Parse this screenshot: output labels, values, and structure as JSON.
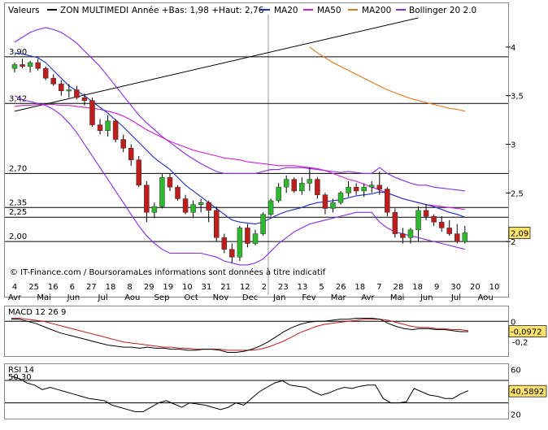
{
  "legend": {
    "title": "Valeurs",
    "instrument": "ZON MULTIMEDI",
    "range": "Année +Bas: 1,98 +Haut: 2,76",
    "items": [
      {
        "label": "MA20",
        "color": "#1f2fbf"
      },
      {
        "label": "MA50",
        "color": "#cc22cc"
      },
      {
        "label": "MA200",
        "color": "#e07a1e"
      },
      {
        "label": "Bollinger 20 2.0",
        "color": "#8a2be2"
      }
    ]
  },
  "colors": {
    "up": "#2db82d",
    "down": "#c01c1c",
    "grid": "#000000",
    "current_value_bg": "#ffe36e"
  },
  "watermark": "© IT-Finance.com / BoursoramaLes informations sont données à titre indicatif",
  "chart_data": [
    {
      "type": "candlestick",
      "title": "",
      "ylim": [
        1.6,
        4.3
      ],
      "y_ticks": [
        2,
        2.5,
        3,
        3.5,
        4
      ],
      "y_tick_labels": [
        "2",
        "2,5",
        "3",
        "3,5",
        "4"
      ],
      "levels": [
        {
          "value": 3.9,
          "label": "3,90"
        },
        {
          "value": 3.42,
          "label": "3,42"
        },
        {
          "value": 2.7,
          "label": "2,70"
        },
        {
          "value": 2.35,
          "label": "2,35"
        },
        {
          "value": 2.25,
          "label": "2,25"
        },
        {
          "value": 2.0,
          "label": "2,00"
        }
      ],
      "current_value": {
        "value": 2.09,
        "label": "2,09"
      },
      "x_ticks": [
        {
          "label": "4",
          "month": "Avr"
        },
        {
          "label": "25",
          "month": "Avr"
        },
        {
          "label": "16",
          "month": "Mai"
        },
        {
          "label": "6",
          "month": "Jun"
        },
        {
          "label": "27",
          "month": "Jun"
        },
        {
          "label": "18",
          "month": "Jul"
        },
        {
          "label": "8",
          "month": "Aou"
        },
        {
          "label": "29",
          "month": "Aou"
        },
        {
          "label": "19",
          "month": "Sep"
        },
        {
          "label": "10",
          "month": "Oct"
        },
        {
          "label": "31",
          "month": "Oct"
        },
        {
          "label": "21",
          "month": "Nov"
        },
        {
          "label": "12",
          "month": "Dec"
        },
        {
          "label": "2",
          "month": "Dec"
        },
        {
          "label": "23",
          "month": "Jan"
        },
        {
          "label": "13",
          "month": "Jan"
        },
        {
          "label": "5",
          "month": "Fev"
        },
        {
          "label": "26",
          "month": "Fev"
        },
        {
          "label": "18",
          "month": "Mar"
        },
        {
          "label": "7",
          "month": "Avr"
        },
        {
          "label": "28",
          "month": "Avr"
        },
        {
          "label": "18",
          "month": "Mai"
        },
        {
          "label": "9",
          "month": "Jun"
        },
        {
          "label": "30",
          "month": "Jun"
        },
        {
          "label": "20",
          "month": "Jul"
        },
        {
          "label": "10",
          "month": "Aou"
        }
      ],
      "month_labels": [
        "Avr",
        "Mai",
        "Jun",
        "Jul",
        "Aou",
        "Sep",
        "Oct",
        "Nov",
        "Dec",
        "Jan",
        "Fev",
        "Mar",
        "Avr",
        "Mai",
        "Jun",
        "Jul",
        "Aou"
      ],
      "candles": [
        [
          3.78,
          3.84,
          3.74,
          3.82
        ],
        [
          3.82,
          3.88,
          3.78,
          3.8
        ],
        [
          3.8,
          3.86,
          3.74,
          3.84
        ],
        [
          3.84,
          3.88,
          3.76,
          3.78
        ],
        [
          3.78,
          3.8,
          3.66,
          3.68
        ],
        [
          3.68,
          3.72,
          3.6,
          3.62
        ],
        [
          3.62,
          3.66,
          3.5,
          3.55
        ],
        [
          3.55,
          3.62,
          3.48,
          3.56
        ],
        [
          3.56,
          3.6,
          3.46,
          3.48
        ],
        [
          3.48,
          3.52,
          3.4,
          3.45
        ],
        [
          3.45,
          3.48,
          3.18,
          3.2
        ],
        [
          3.2,
          3.26,
          3.1,
          3.14
        ],
        [
          3.14,
          3.3,
          3.08,
          3.24
        ],
        [
          3.24,
          3.26,
          3.02,
          3.05
        ],
        [
          3.05,
          3.1,
          2.92,
          2.96
        ],
        [
          2.96,
          3.0,
          2.78,
          2.84
        ],
        [
          2.84,
          2.88,
          2.56,
          2.58
        ],
        [
          2.58,
          2.62,
          2.2,
          2.3
        ],
        [
          2.3,
          2.4,
          2.24,
          2.36
        ],
        [
          2.36,
          2.7,
          2.34,
          2.66
        ],
        [
          2.66,
          2.7,
          2.52,
          2.56
        ],
        [
          2.56,
          2.58,
          2.42,
          2.44
        ],
        [
          2.44,
          2.48,
          2.28,
          2.3
        ],
        [
          2.3,
          2.42,
          2.24,
          2.38
        ],
        [
          2.38,
          2.44,
          2.3,
          2.4
        ],
        [
          2.4,
          2.42,
          2.2,
          2.32
        ],
        [
          2.32,
          2.36,
          2.0,
          2.04
        ],
        [
          2.04,
          2.08,
          1.88,
          1.92
        ],
        [
          1.92,
          1.98,
          1.78,
          1.84
        ],
        [
          1.84,
          2.16,
          1.8,
          2.14
        ],
        [
          2.14,
          2.18,
          1.94,
          1.98
        ],
        [
          1.98,
          2.12,
          1.96,
          2.08
        ],
        [
          2.08,
          2.3,
          2.06,
          2.28
        ],
        [
          2.28,
          2.44,
          2.26,
          2.42
        ],
        [
          2.42,
          2.6,
          2.4,
          2.56
        ],
        [
          2.56,
          2.68,
          2.5,
          2.64
        ],
        [
          2.64,
          2.66,
          2.5,
          2.52
        ],
        [
          2.52,
          2.66,
          2.48,
          2.6
        ],
        [
          2.6,
          2.76,
          2.52,
          2.64
        ],
        [
          2.64,
          2.66,
          2.44,
          2.48
        ],
        [
          2.48,
          2.5,
          2.28,
          2.34
        ],
        [
          2.34,
          2.44,
          2.3,
          2.4
        ],
        [
          2.4,
          2.52,
          2.38,
          2.5
        ],
        [
          2.5,
          2.62,
          2.46,
          2.56
        ],
        [
          2.56,
          2.6,
          2.48,
          2.52
        ],
        [
          2.52,
          2.6,
          2.46,
          2.56
        ],
        [
          2.56,
          2.62,
          2.5,
          2.58
        ],
        [
          2.58,
          2.72,
          2.48,
          2.54
        ],
        [
          2.54,
          2.56,
          2.26,
          2.3
        ],
        [
          2.3,
          2.34,
          2.04,
          2.08
        ],
        [
          2.08,
          2.14,
          1.98,
          2.04
        ],
        [
          2.04,
          2.14,
          1.98,
          2.12
        ],
        [
          2.12,
          2.36,
          2.0,
          2.32
        ],
        [
          2.32,
          2.38,
          2.22,
          2.26
        ],
        [
          2.26,
          2.28,
          2.16,
          2.2
        ],
        [
          2.2,
          2.26,
          2.1,
          2.14
        ],
        [
          2.14,
          2.22,
          2.06,
          2.08
        ],
        [
          2.08,
          2.18,
          1.98,
          2.0
        ],
        [
          2.0,
          2.16,
          1.98,
          2.09
        ]
      ],
      "ma20": [
        3.94,
        3.93,
        3.91,
        3.89,
        3.84,
        3.76,
        3.68,
        3.6,
        3.55,
        3.5,
        3.44,
        3.38,
        3.32,
        3.25,
        3.18,
        3.1,
        3.02,
        2.94,
        2.86,
        2.8,
        2.74,
        2.66,
        2.58,
        2.52,
        2.46,
        2.4,
        2.34,
        2.28,
        2.22,
        2.2,
        2.19,
        2.18,
        2.2,
        2.24,
        2.28,
        2.31,
        2.33,
        2.35,
        2.38,
        2.4,
        2.41,
        2.42,
        2.43,
        2.45,
        2.47,
        2.48,
        2.49,
        2.51,
        2.5,
        2.47,
        2.44,
        2.42,
        2.4,
        2.38,
        2.36,
        2.33,
        2.3,
        2.28,
        2.25
      ],
      "ma50": [
        3.39,
        3.4,
        3.4,
        3.41,
        3.41,
        3.41,
        3.4,
        3.4,
        3.39,
        3.38,
        3.37,
        3.36,
        3.34,
        3.32,
        3.29,
        3.25,
        3.2,
        3.15,
        3.11,
        3.07,
        3.03,
        3.0,
        2.97,
        2.94,
        2.92,
        2.9,
        2.88,
        2.86,
        2.85,
        2.84,
        2.82,
        2.81,
        2.8,
        2.79,
        2.78,
        2.78,
        2.78,
        2.77,
        2.76,
        2.75,
        2.73,
        2.7,
        2.67,
        2.64,
        2.62,
        2.59,
        2.56,
        2.53,
        2.5,
        2.47,
        2.44,
        2.42,
        2.4,
        2.38,
        2.37,
        2.36,
        2.35,
        2.34,
        2.33
      ],
      "ma200": [
        null,
        null,
        null,
        null,
        null,
        null,
        null,
        null,
        null,
        null,
        null,
        null,
        null,
        null,
        null,
        null,
        null,
        null,
        null,
        null,
        null,
        null,
        null,
        null,
        null,
        null,
        null,
        null,
        null,
        null,
        null,
        null,
        null,
        null,
        null,
        null,
        null,
        null,
        4.0,
        3.94,
        3.89,
        3.84,
        3.8,
        3.76,
        3.72,
        3.68,
        3.64,
        3.6,
        3.56,
        3.53,
        3.5,
        3.47,
        3.45,
        3.43,
        3.41,
        3.39,
        3.37,
        3.36,
        3.34
      ],
      "boll_upper": [
        4.05,
        4.1,
        4.15,
        4.18,
        4.2,
        4.18,
        4.15,
        4.1,
        4.04,
        3.96,
        3.88,
        3.8,
        3.7,
        3.6,
        3.5,
        3.4,
        3.3,
        3.22,
        3.15,
        3.08,
        3.02,
        2.96,
        2.9,
        2.85,
        2.8,
        2.76,
        2.72,
        2.7,
        2.7,
        2.7,
        2.7,
        2.7,
        2.72,
        2.74,
        2.74,
        2.76,
        2.76,
        2.76,
        2.75,
        2.74,
        2.73,
        2.72,
        2.71,
        2.72,
        2.71,
        2.7,
        2.7,
        2.76,
        2.7,
        2.66,
        2.63,
        2.6,
        2.58,
        2.58,
        2.56,
        2.55,
        2.54,
        2.53,
        2.52
      ],
      "boll_lower": [
        3.5,
        3.46,
        3.44,
        3.42,
        3.4,
        3.36,
        3.3,
        3.22,
        3.12,
        3.0,
        2.88,
        2.76,
        2.64,
        2.52,
        2.4,
        2.28,
        2.16,
        2.06,
        1.98,
        1.92,
        1.88,
        1.88,
        1.88,
        1.88,
        1.88,
        1.86,
        1.84,
        1.8,
        1.78,
        1.76,
        1.76,
        1.78,
        1.82,
        1.9,
        1.98,
        2.04,
        2.1,
        2.14,
        2.18,
        2.2,
        2.22,
        2.24,
        2.26,
        2.28,
        2.3,
        2.3,
        2.3,
        2.2,
        2.14,
        2.1,
        2.08,
        2.06,
        2.04,
        2.02,
        2.0,
        1.98,
        1.96,
        1.94,
        1.92
      ],
      "trendline": {
        "from": [
          0,
          3.34
        ],
        "to": [
          52,
          4.3
        ]
      }
    },
    {
      "type": "line",
      "name": "MACD 12 26 9",
      "ylim": [
        -0.32,
        0.12
      ],
      "y_ticks": [
        -0.2
      ],
      "y_tick_labels": [
        "-0,2"
      ],
      "zero_label": "0",
      "current_value": {
        "value": -0.0972,
        "label": "-0,0972"
      },
      "macd": [
        0.02,
        0.02,
        0.0,
        -0.02,
        -0.05,
        -0.08,
        -0.11,
        -0.13,
        -0.15,
        -0.17,
        -0.19,
        -0.21,
        -0.23,
        -0.24,
        -0.25,
        -0.25,
        -0.26,
        -0.25,
        -0.26,
        -0.26,
        -0.27,
        -0.27,
        -0.28,
        -0.28,
        -0.27,
        -0.27,
        -0.28,
        -0.3,
        -0.3,
        -0.29,
        -0.27,
        -0.24,
        -0.2,
        -0.15,
        -0.1,
        -0.06,
        -0.03,
        -0.01,
        0.0,
        0.0,
        0.01,
        0.02,
        0.02,
        0.03,
        0.03,
        0.03,
        0.02,
        -0.02,
        -0.05,
        -0.07,
        -0.08,
        -0.07,
        -0.07,
        -0.08,
        -0.08,
        -0.09,
        -0.1,
        -0.1
      ],
      "signal": [
        0.03,
        0.03,
        0.02,
        0.01,
        0.0,
        -0.02,
        -0.04,
        -0.06,
        -0.08,
        -0.1,
        -0.12,
        -0.14,
        -0.16,
        -0.18,
        -0.2,
        -0.21,
        -0.22,
        -0.23,
        -0.24,
        -0.25,
        -0.25,
        -0.26,
        -0.26,
        -0.27,
        -0.27,
        -0.27,
        -0.27,
        -0.28,
        -0.28,
        -0.28,
        -0.28,
        -0.27,
        -0.25,
        -0.22,
        -0.19,
        -0.15,
        -0.11,
        -0.08,
        -0.05,
        -0.03,
        -0.02,
        -0.01,
        0.0,
        0.01,
        0.02,
        0.02,
        0.02,
        0.01,
        -0.01,
        -0.03,
        -0.05,
        -0.06,
        -0.06,
        -0.07,
        -0.07,
        -0.08,
        -0.08,
        -0.09
      ]
    },
    {
      "type": "line",
      "name": "RSI 14",
      "second_label": "50,30",
      "ylim": [
        18,
        62
      ],
      "y_ticks": [
        60,
        20
      ],
      "y_tick_labels": [
        "60",
        "20"
      ],
      "levels": [
        50.3,
        30
      ],
      "current_value": {
        "value": 40.5892,
        "label": "40,5892"
      },
      "values": [
        54,
        52,
        48,
        46,
        42,
        44,
        42,
        40,
        38,
        36,
        34,
        33,
        32,
        28,
        26,
        24,
        22,
        22,
        26,
        30,
        32,
        29,
        26,
        30,
        29,
        28,
        26,
        24,
        26,
        30,
        28,
        34,
        40,
        44,
        48,
        50,
        46,
        45,
        44,
        40,
        37,
        39,
        42,
        44,
        43,
        45,
        46,
        46,
        34,
        30,
        30,
        31,
        43,
        40,
        37,
        36,
        34,
        34,
        38,
        41
      ]
    }
  ]
}
